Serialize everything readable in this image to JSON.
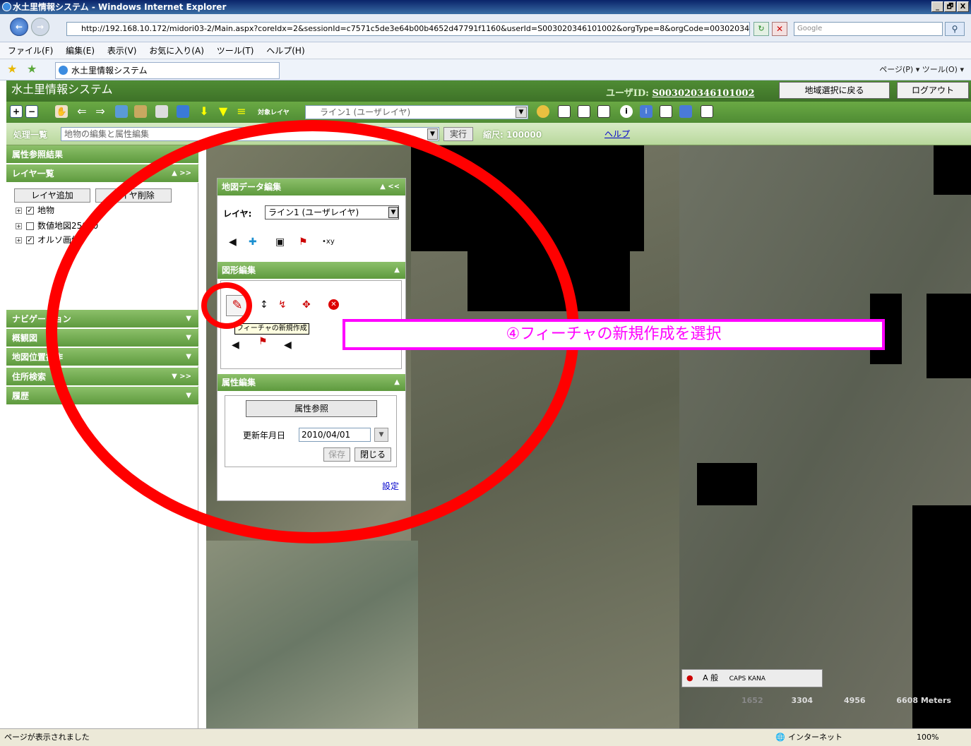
{
  "window": {
    "title": "水土里情報システム - Windows Internet Explorer",
    "min": "_",
    "max": "🗗",
    "close": "X"
  },
  "address": {
    "url": "http://192.168.10.172/midori03-2/Main.aspx?coreIdx=2&sessionId=c7571c5de3e64b00b4652d47791f1160&userId=S003020346101002&orgType=8&orgCode=003020346101%",
    "search_placeholder": "Google"
  },
  "menu": [
    "ファイル(F)",
    "編集(E)",
    "表示(V)",
    "お気に入り(A)",
    "ツール(T)",
    "ヘルプ(H)"
  ],
  "favbar": {
    "tab": "水土里情報システム",
    "commands": "ページ(P) ▾  ツール(O) ▾"
  },
  "app": {
    "title": "水土里情報システム",
    "user_label": "ユーザID:",
    "user_id": "S003020346101002",
    "region_button": "地域選択に戻る",
    "logout_button": "ログアウト"
  },
  "toolbar": {
    "target_label": "対象レイヤ",
    "target_layer": "ライン1 (ユーザレイヤ)"
  },
  "process": {
    "label": "処理一覧",
    "value": "地物の編集と属性編集",
    "exec": "実行",
    "scale": "縮尺: 100000",
    "help": "ヘルプ"
  },
  "sidebar": {
    "attr_results": "属性参照結果",
    "layer_list": "レイヤ一覧",
    "add_layer": "レイヤ追加",
    "remove_layer": "レイヤ削除",
    "layers": [
      {
        "label": "地物",
        "checked": "✓"
      },
      {
        "label": "数値地図25000",
        "checked": ""
      },
      {
        "label": "オルソ画像",
        "checked": "✓"
      }
    ],
    "navigation": "ナビゲーション",
    "overview": "概観図",
    "position": "地図位置操作",
    "address_search": "住所検索",
    "history": "履歴"
  },
  "dialog": {
    "title": "地図データ編集",
    "layer_label": "レイヤ:",
    "layer_value": "ライン1 (ユーザレイヤ)",
    "shape_edit": "図形編集",
    "attr_edit": "属性編集",
    "attr_ref_button": "属性参照",
    "date_label": "更新年月日",
    "date_value": "2010/04/01",
    "save": "保存",
    "close": "閉じる",
    "settings": "設定",
    "tooltip": "フィーチャの新規作成"
  },
  "annotation": {
    "callout": "④フィーチャの新規作成を選択"
  },
  "map": {
    "scale_labels": [
      "1652",
      "3304",
      "4956",
      "6608 Meters"
    ],
    "ime": "A 般",
    "caps": "CAPS KANA"
  },
  "status": {
    "text": "ページが表示されました",
    "zone": "インターネット",
    "zoom": "100%"
  }
}
